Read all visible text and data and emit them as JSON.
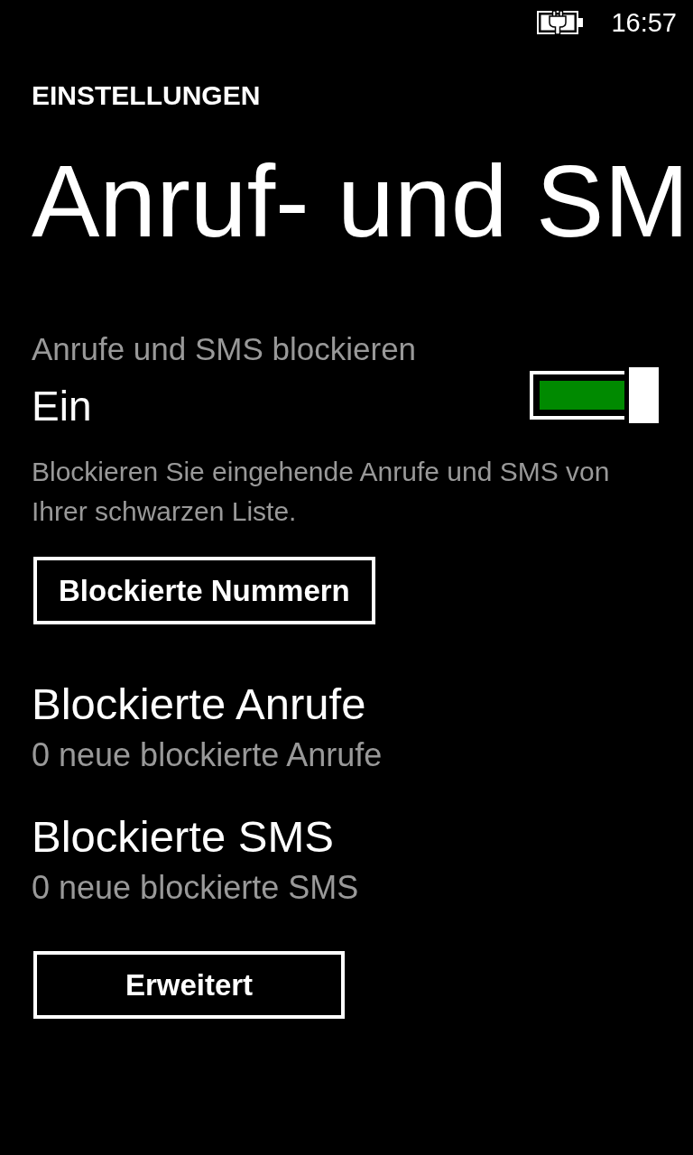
{
  "status_bar": {
    "charging": true,
    "time": "16:57"
  },
  "header": {
    "app_title": "EINSTELLUNGEN",
    "page_title": "Anruf- und SM"
  },
  "block_setting": {
    "label": "Anrufe und SMS blockieren",
    "state_text": "Ein",
    "on": true,
    "description": "Blockieren Sie eingehende Anrufe und SMS von Ihrer schwarzen Liste."
  },
  "blocked_numbers_button": {
    "label": "Blockierte Nummern"
  },
  "sections": [
    {
      "title": "Blockierte Anrufe",
      "subtitle": "0 neue blockierte Anrufe"
    },
    {
      "title": "Blockierte SMS",
      "subtitle": "0 neue blockierte SMS"
    }
  ],
  "advanced_button": {
    "label": "Erweitert"
  }
}
